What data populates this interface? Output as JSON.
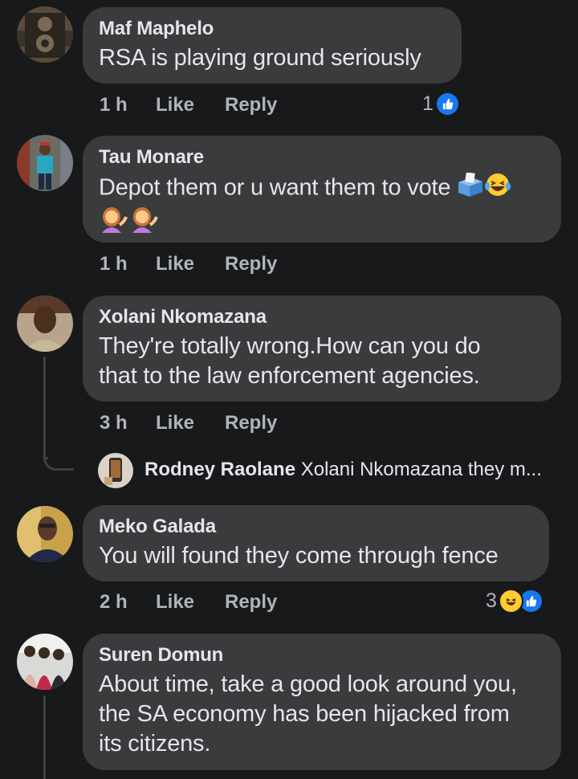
{
  "comments": [
    {
      "name": "Maf Maphelo",
      "text": "RSA is playing ground seriously",
      "time": "1 h",
      "like": "Like",
      "reply": "Reply",
      "reaction_count": "1",
      "reaction_icons": [
        "like-icon"
      ]
    },
    {
      "name": "Tau Monare",
      "text": "Depot them or u want them to vote",
      "emoji_line1": [
        "ballot-box-icon",
        "laughing-tears-icon"
      ],
      "emoji_line2": [
        "woman-tipping-hand-icon",
        "woman-tipping-hand-icon"
      ],
      "time": "1 h",
      "like": "Like",
      "reply": "Reply"
    },
    {
      "name": "Xolani Nkomazana",
      "text_line1": "They're totally wrong.How can you do",
      "text_line2": "that to the law enforcement agencies.",
      "time": "3 h",
      "like": "Like",
      "reply": "Reply",
      "reply_preview": {
        "name": "Rodney Raolane",
        "text": "Xolani Nkomazana they m..."
      }
    },
    {
      "name": "Meko Galada",
      "text": "You will found they come through fence",
      "time": "2 h",
      "like": "Like",
      "reply": "Reply",
      "reaction_count": "3",
      "reaction_icons": [
        "laughing-tears-icon",
        "like-icon"
      ]
    },
    {
      "name": "Suren Domun",
      "text_line1": "About time, take a good look around you,",
      "text_line2": "the SA economy has been hijacked from",
      "text_line3": "its citizens."
    }
  ],
  "colors": {
    "background": "#18191a",
    "bubble": "#3a3b3c",
    "like_blue": "#1877f2",
    "meta_text": "#b0b3b8"
  }
}
